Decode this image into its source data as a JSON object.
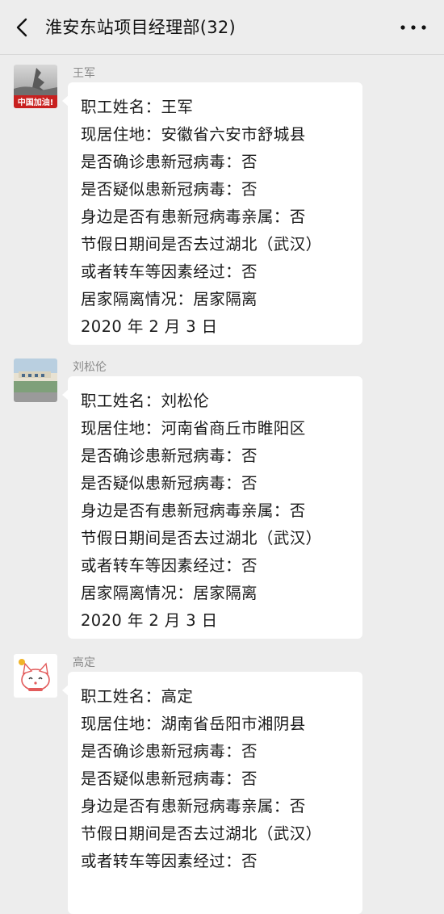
{
  "header": {
    "title": "淮安东站项目经理部(32)",
    "back_icon": "chevron-left-icon",
    "more_icon": "more-dots-icon"
  },
  "messages": [
    {
      "sender": "王军",
      "avatar_text": "中国加油!",
      "lines": [
        "职工姓名：王军",
        "现居住地：安徽省六安市舒城县",
        "是否确诊患新冠病毒：否",
        "是否疑似患新冠病毒：否",
        "身边是否有患新冠病毒亲属：否",
        "节假日期间是否去过湖北（武汉）",
        "或者转车等因素经过：否",
        "居家隔离情况：居家隔离",
        "2020 年 2 月 3 日"
      ]
    },
    {
      "sender": "刘松伦",
      "lines": [
        "职工姓名：刘松伦",
        "现居住地：河南省商丘市睢阳区",
        "是否确诊患新冠病毒：否",
        "是否疑似患新冠病毒：否",
        "身边是否有患新冠病毒亲属：否",
        "节假日期间是否去过湖北（武汉）",
        "或者转车等因素经过：否",
        "居家隔离情况：居家隔离",
        "2020 年 2 月 3 日"
      ]
    },
    {
      "sender": "高定",
      "lines": [
        "职工姓名：高定",
        "现居住地：湖南省岳阳市湘阴县",
        "是否确诊患新冠病毒：否",
        "是否疑似患新冠病毒：否",
        "身边是否有患新冠病毒亲属：否",
        "节假日期间是否去过湖北（武汉）",
        "或者转车等因素经过：否"
      ]
    }
  ]
}
